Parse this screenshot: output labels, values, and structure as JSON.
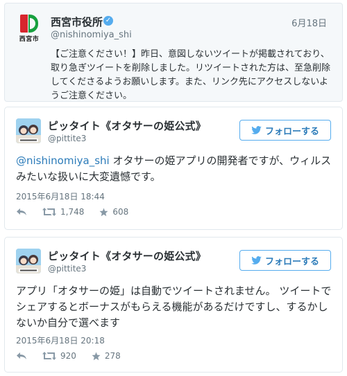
{
  "quoted_tweet": {
    "city_label": "西宮市",
    "display_name": "西宮市役所",
    "verified_mark": "✓",
    "handle": "@nishinomiya_shi",
    "date": "6月18日",
    "text": "【ご注意ください！】昨日、意図しないツイートが掲載されており、取り急ぎツイートを削除しました。リツイートされた方は、至急削除してくださるようお願いします。また、リンク先にアクセスしないようご注意ください。",
    "logo_colors": {
      "red": "#d7262e",
      "green": "#17a03e"
    }
  },
  "tweets": [
    {
      "display_name": "ピッタイト《オタサーの姫公式》",
      "handle": "@pittite3",
      "follow_label": "フォローする",
      "mention": "@nishinomiya_shi",
      "text": " オタサーの姫アプリの開発者ですが、ウィルスみたいな扱いに大変遺憾です。",
      "timestamp": "2015年6月18日 18:44",
      "retweets": "1,748",
      "favorites": "608",
      "icons": [
        "reply-icon",
        "retweet-icon",
        "favorite-icon"
      ]
    },
    {
      "display_name": "ピッタイト《オタサーの姫公式》",
      "handle": "@pittite3",
      "follow_label": "フォローする",
      "text": "アプリ「オタサーの姫」は自動でツイートされません。 ツイートでシェアするとボーナスがもらえる機能があるだけですし、するかしないか自分で選べます",
      "timestamp": "2015年6月18日 20:18",
      "retweets": "920",
      "favorites": "278",
      "icons": [
        "reply-icon",
        "retweet-icon",
        "favorite-icon"
      ]
    }
  ],
  "colors": {
    "link": "#2b7bb9",
    "follow_border": "#55acee",
    "muted": "#66757f",
    "text": "#292f33"
  }
}
